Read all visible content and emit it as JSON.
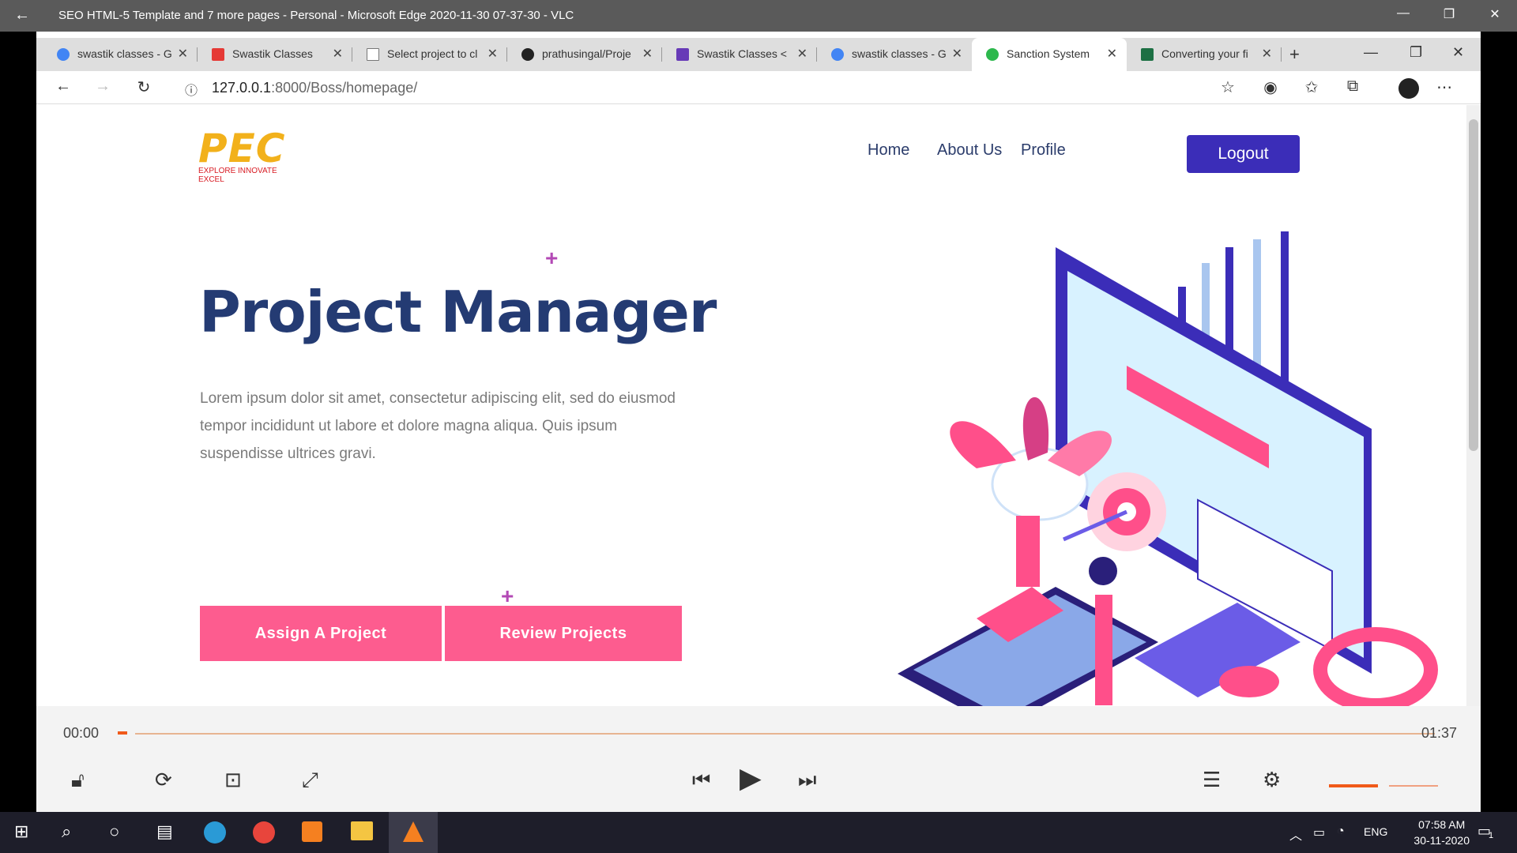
{
  "vlc": {
    "title": "SEO HTML-5 Template and 7 more pages - Personal - Microsoft Edge 2020-11-30 07-37-30 - VLC",
    "time_elapsed": "00:00",
    "time_total": "01:37"
  },
  "browser": {
    "tabs": [
      {
        "label": "swastik classes - G",
        "icon": "google-icon",
        "color": "#4285f4"
      },
      {
        "label": "Swastik Classes",
        "icon": "site-icon",
        "color": "#e53935"
      },
      {
        "label": "Select project to cl",
        "icon": "page-icon",
        "color": "#888888"
      },
      {
        "label": "prathusingal/Proje",
        "icon": "github-icon",
        "color": "#222222"
      },
      {
        "label": "Swastik Classes <",
        "icon": "form-icon",
        "color": "#673ab7"
      },
      {
        "label": "swastik classes - G",
        "icon": "google-icon",
        "color": "#4285f4"
      },
      {
        "label": "Sanction System",
        "icon": "check-circle-icon",
        "color": "#2db84d"
      },
      {
        "label": "Converting your fi",
        "icon": "excel-icon",
        "color": "#1d7044"
      }
    ],
    "url_host": "127.0.0.1",
    "url_path": ":8000/Boss/homepage/"
  },
  "site": {
    "logo_text": "PEC",
    "logo_tagline": "EXPLORE INNOVATE EXCEL",
    "nav": [
      "Home",
      "About Us",
      "Profile"
    ],
    "logout_label": "Logout",
    "hero_title": "Project Manager",
    "hero_text": "Lorem ipsum dolor sit amet, consectetur adipiscing elit, sed do eiusmod tempor incididunt ut labore et dolore magna aliqua. Quis ipsum suspendisse ultrices gravi.",
    "button_assign": "Assign A Project",
    "button_review": "Review Projects",
    "accent_color": "#fd5c8f",
    "primary_color": "#3b2db8"
  },
  "taskbar": {
    "lang": "ENG",
    "time": "07:58 AM",
    "date": "30-11-2020",
    "notification_count": "1"
  }
}
